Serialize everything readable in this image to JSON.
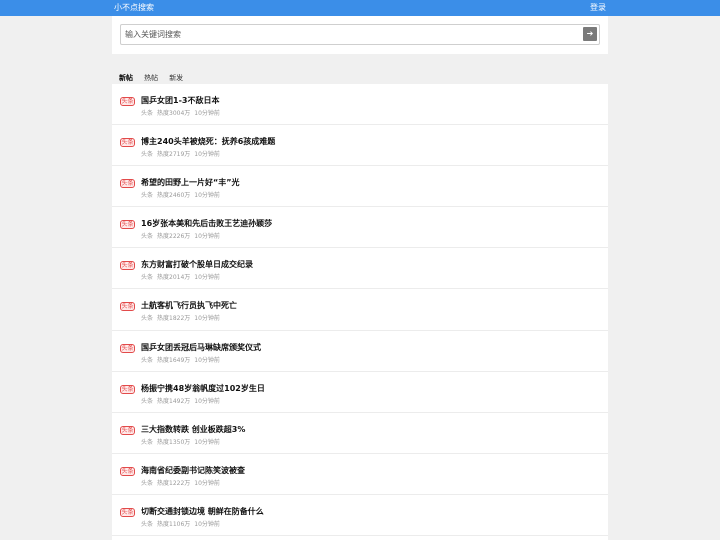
{
  "header": {
    "brand": "小不点搜索",
    "login_label": "登录"
  },
  "search": {
    "placeholder": "输入关键词搜索",
    "button_label": "➔"
  },
  "tabs": [
    {
      "label": "新帖",
      "active": true
    },
    {
      "label": "热帖",
      "active": false
    },
    {
      "label": "新发",
      "active": false
    }
  ],
  "items": [
    {
      "badge": "头条",
      "title": "国乒女团1-3不敌日本",
      "source": "头条",
      "heat": "热度3004万",
      "time": "10分钟前"
    },
    {
      "badge": "头条",
      "title": "博主240头羊被烧死：抚养6孩成难题",
      "source": "头条",
      "heat": "热度2719万",
      "time": "10分钟前"
    },
    {
      "badge": "头条",
      "title": "希望的田野上一片好“丰”光",
      "source": "头条",
      "heat": "热度2460万",
      "time": "10分钟前"
    },
    {
      "badge": "头条",
      "title": "16岁张本美和先后击败王艺迪孙颖莎",
      "source": "头条",
      "heat": "热度2226万",
      "time": "10分钟前"
    },
    {
      "badge": "头条",
      "title": "东方财富打破个股单日成交纪录",
      "source": "头条",
      "heat": "热度2014万",
      "time": "10分钟前"
    },
    {
      "badge": "头条",
      "title": "土航客机飞行员执飞中死亡",
      "source": "头条",
      "heat": "热度1822万",
      "time": "10分钟前"
    },
    {
      "badge": "头条",
      "title": "国乒女团丢冠后马琳缺席颁奖仪式",
      "source": "头条",
      "heat": "热度1649万",
      "time": "10分钟前"
    },
    {
      "badge": "头条",
      "title": "杨振宁携48岁翁帆度过102岁生日",
      "source": "头条",
      "heat": "热度1492万",
      "time": "10分钟前"
    },
    {
      "badge": "头条",
      "title": "三大指数转跌 创业板跌超3%",
      "source": "头条",
      "heat": "热度1350万",
      "time": "10分钟前"
    },
    {
      "badge": "头条",
      "title": "海南省纪委副书记陈笑波被查",
      "source": "头条",
      "heat": "热度1222万",
      "time": "10分钟前"
    },
    {
      "badge": "头条",
      "title": "切断交通封锁边境 朝鲜在防备什么",
      "source": "头条",
      "heat": "热度1106万",
      "time": "10分钟前"
    }
  ]
}
